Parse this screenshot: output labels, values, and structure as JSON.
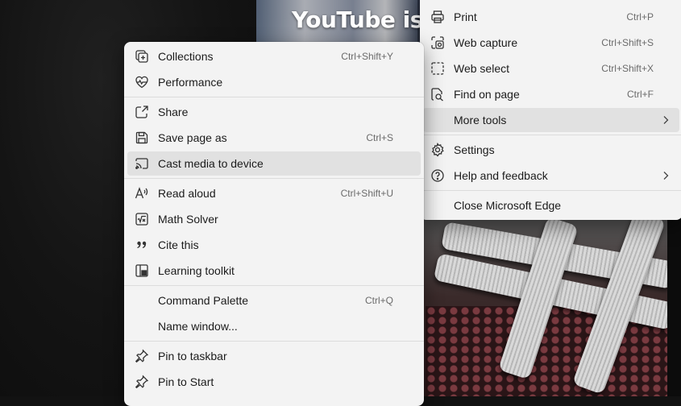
{
  "background": {
    "video_title": "YouTube is tl"
  },
  "main_menu": {
    "items": [
      {
        "label": "Print",
        "shortcut": "Ctrl+P",
        "icon": "printer-icon"
      },
      {
        "label": "Web capture",
        "shortcut": "Ctrl+Shift+S",
        "icon": "web-capture-icon"
      },
      {
        "label": "Web select",
        "shortcut": "Ctrl+Shift+X",
        "icon": "web-select-icon"
      },
      {
        "label": "Find on page",
        "shortcut": "Ctrl+F",
        "icon": "find-icon"
      },
      {
        "label": "More tools",
        "shortcut": "",
        "icon": "",
        "submenu": true,
        "highlighted": true
      },
      {
        "label": "Settings",
        "shortcut": "",
        "icon": "gear-icon"
      },
      {
        "label": "Help and feedback",
        "shortcut": "",
        "icon": "help-icon",
        "submenu": true
      },
      {
        "label": "Close Microsoft Edge",
        "shortcut": "",
        "icon": ""
      }
    ]
  },
  "more_tools_menu": {
    "items": [
      {
        "label": "Collections",
        "shortcut": "Ctrl+Shift+Y",
        "icon": "collections-icon"
      },
      {
        "label": "Performance",
        "shortcut": "",
        "icon": "performance-icon"
      },
      {
        "label": "Share",
        "shortcut": "",
        "icon": "share-icon"
      },
      {
        "label": "Save page as",
        "shortcut": "Ctrl+S",
        "icon": "save-icon"
      },
      {
        "label": "Cast media to device",
        "shortcut": "",
        "icon": "cast-icon",
        "highlighted": true
      },
      {
        "label": "Read aloud",
        "shortcut": "Ctrl+Shift+U",
        "icon": "read-aloud-icon"
      },
      {
        "label": "Math Solver",
        "shortcut": "",
        "icon": "math-solver-icon"
      },
      {
        "label": "Cite this",
        "shortcut": "",
        "icon": "quote-icon"
      },
      {
        "label": "Learning toolkit",
        "shortcut": "",
        "icon": "learning-toolkit-icon"
      },
      {
        "label": "Command Palette",
        "shortcut": "Ctrl+Q",
        "icon": ""
      },
      {
        "label": "Name window...",
        "shortcut": "",
        "icon": ""
      },
      {
        "label": "Pin to taskbar",
        "shortcut": "",
        "icon": "pin-icon"
      },
      {
        "label": "Pin to Start",
        "shortcut": "",
        "icon": "pin-icon"
      }
    ]
  }
}
